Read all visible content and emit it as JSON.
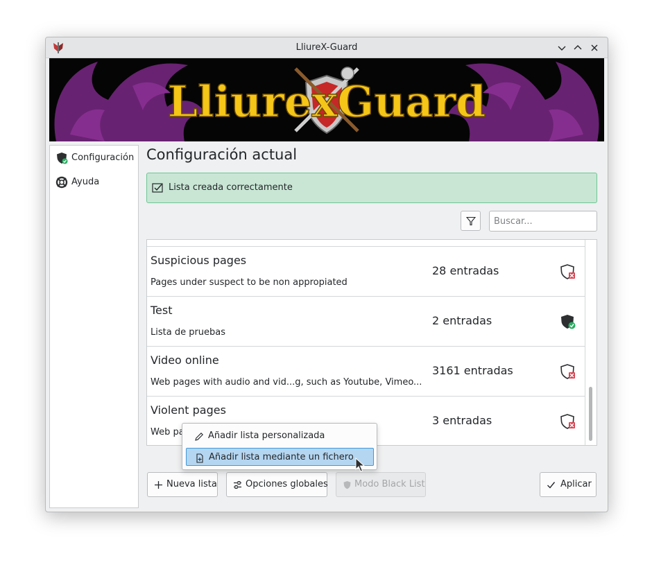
{
  "window": {
    "title": "LliureX-Guard"
  },
  "banner": {
    "logo_text": "LliurexGuard"
  },
  "sidebar": {
    "items": [
      {
        "label": "Configuración",
        "icon": "shield-check-icon"
      },
      {
        "label": "Ayuda",
        "icon": "lifebuoy-icon"
      }
    ]
  },
  "main": {
    "title": "Configuración actual",
    "notice": "Lista creada correctamente",
    "search": {
      "placeholder": "Buscar..."
    }
  },
  "lists": [
    {
      "name": "Suspicious pages",
      "description": "Pages under suspect to be non appropiated",
      "count": "28 entradas",
      "active": false
    },
    {
      "name": "Test",
      "description": "Lista de pruebas",
      "count": "2 entradas",
      "active": true
    },
    {
      "name": "Video online",
      "description": "Web pages with audio and vid...g, such as Youtube, Vimeo...",
      "count": "3161 entradas",
      "active": false
    },
    {
      "name": "Violent pages",
      "description": "Web pa",
      "count": "3 entradas",
      "active": false
    }
  ],
  "context_menu": {
    "items": [
      {
        "label": "Añadir lista personalizada",
        "icon": "pencil-icon"
      },
      {
        "label": "Añadir lista mediante un fichero",
        "icon": "file-add-icon"
      }
    ]
  },
  "footer": {
    "new_list": "Nueva lista",
    "global_options": "Opciones globales",
    "blacklist_mode": "Modo Black List",
    "apply": "Aplicar"
  },
  "colors": {
    "notice_bg": "#c9e6d5",
    "notice_border": "#6ec695",
    "menu_highlight": "#b5d6f1",
    "banner_dragon": "#7a2a86",
    "banner_text": "#f5c518"
  }
}
